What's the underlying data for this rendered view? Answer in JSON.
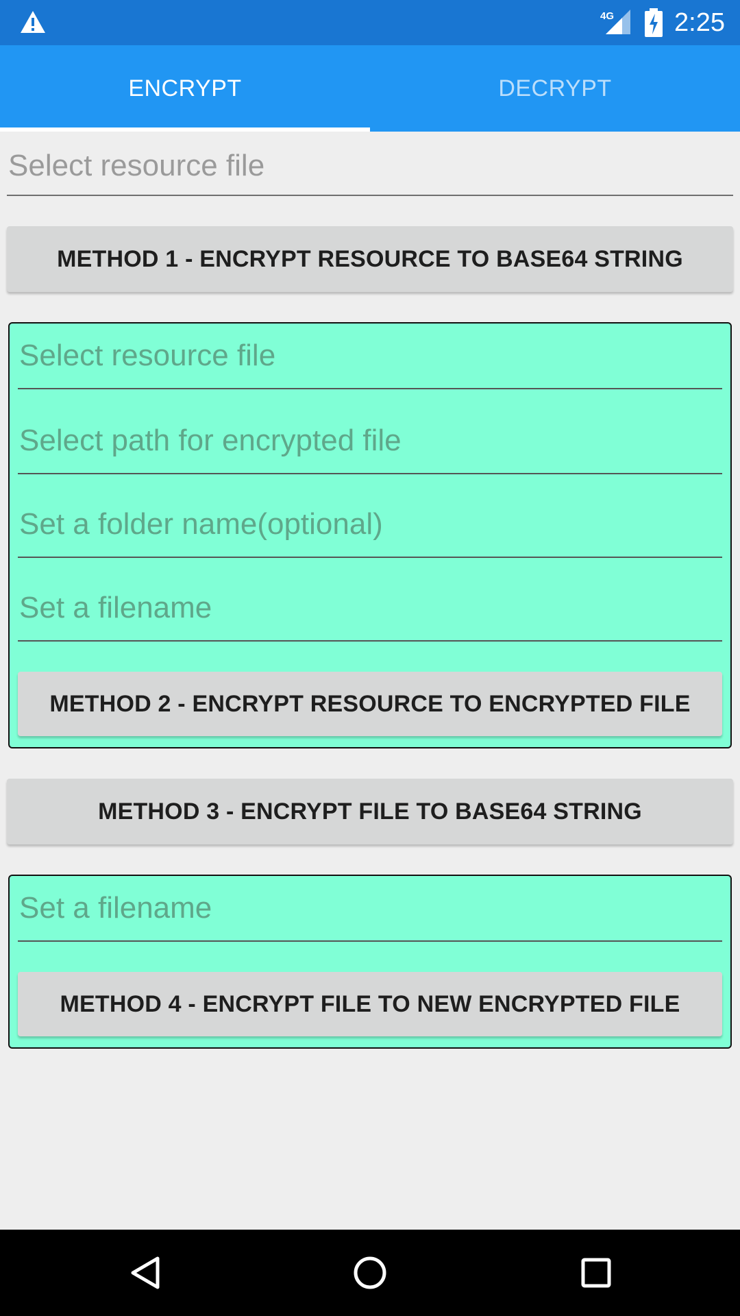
{
  "status_bar": {
    "warning_icon": "warning-triangle-icon",
    "network_label": "4G",
    "signal_icon": "cell-signal-icon",
    "battery_icon": "battery-charging-icon",
    "time": "2:25"
  },
  "tabs": [
    {
      "label": "ENCRYPT",
      "active": true
    },
    {
      "label": "DECRYPT",
      "active": false
    }
  ],
  "method1": {
    "resource_placeholder": "Select resource file",
    "button_label": "METHOD 1 - ENCRYPT RESOURCE TO BASE64 STRING"
  },
  "method2": {
    "resource_placeholder": "Select resource file",
    "path_placeholder": "Select path for encrypted file",
    "folder_placeholder": "Set a folder name(optional)",
    "filename_placeholder": "Set a filename",
    "button_label": "METHOD 2 - ENCRYPT RESOURCE TO ENCRYPTED FILE"
  },
  "method3": {
    "button_label": "METHOD 3 - ENCRYPT FILE TO BASE64 STRING"
  },
  "method4": {
    "filename_placeholder": "Set a filename",
    "button_label": "METHOD 4 - ENCRYPT FILE TO NEW ENCRYPTED FILE"
  },
  "nav": {
    "back_icon": "back-triangle-icon",
    "home_icon": "home-circle-icon",
    "recents_icon": "recents-square-icon"
  },
  "colors": {
    "status_bar": "#1976d2",
    "tab_bar": "#2196f3",
    "group_background": "#80ffd6",
    "button_background": "#d6d7d7"
  }
}
